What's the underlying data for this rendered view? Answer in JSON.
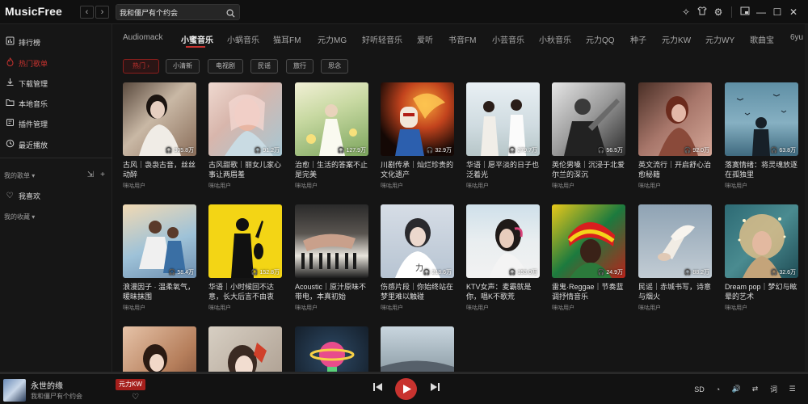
{
  "app": {
    "title": "MusicFree"
  },
  "search": {
    "value": "我和僵尸有个约会"
  },
  "sidebar": {
    "items": [
      {
        "label": "排行榜",
        "icon": "ranking-icon"
      },
      {
        "label": "热门歌单",
        "icon": "fire-icon"
      },
      {
        "label": "下载管理",
        "icon": "download-icon"
      },
      {
        "label": "本地音乐",
        "icon": "folder-icon"
      },
      {
        "label": "插件管理",
        "icon": "plugin-icon"
      },
      {
        "label": "最近播放",
        "icon": "clock-icon"
      }
    ],
    "my_playlists": "我的歌单",
    "favorites": "我喜欢",
    "my_collections": "我的收藏"
  },
  "tabs": [
    "Audiomack",
    "小蜜音乐",
    "小蜗音乐",
    "猫耳FM",
    "元力MG",
    "好听轻音乐",
    "爱听",
    "书音FM",
    "小芸音乐",
    "小秋音乐",
    "元力QQ",
    "种子",
    "元力KW",
    "元力WY",
    "歌曲宝",
    "6yu"
  ],
  "chips": [
    "热门",
    "小清新",
    "电视剧",
    "民谣",
    "旅行",
    "思念"
  ],
  "cards": [
    {
      "title": "古风｜袅袅古音，丝丝动醉",
      "count": "305.8万",
      "user": "咪咕用户"
    },
    {
      "title": "古风甜歌｜丽女儿家心事让两眉羞",
      "count": "91.2万",
      "user": "咪咕用户"
    },
    {
      "title": "治愈｜生活的答案不止是完美",
      "count": "127.9万",
      "user": "咪咕用户"
    },
    {
      "title": "川剧传承｜灿烂珍贵的文化遗产",
      "count": "32.9万",
      "user": "咪咕用户"
    },
    {
      "title": "华语｜愿平淡的日子也泛着光",
      "count": "279.7万",
      "user": "咪咕用户"
    },
    {
      "title": "英伦男嗓｜沉浸于北爱尔兰的深沉",
      "count": "56.5万",
      "user": "咪咕用户"
    },
    {
      "title": "英文流行｜开启舒心治愈秘籍",
      "count": "92.0万",
      "user": "咪咕用户"
    },
    {
      "title": "落寞情绪：将灵魂放逐在孤独里",
      "count": "63.8万",
      "user": "咪咕用户"
    },
    {
      "title": "浪漫因子 · 温柔氧气，暖昧抹围",
      "count": "58.4万",
      "user": "咪咕用户"
    },
    {
      "title": "华语｜小时候回不达意，长大后言不由衷",
      "count": "152.8万",
      "user": "咪咕用户"
    },
    {
      "title": "Acoustic｜原汁原味不带电，本真初始",
      "count": "",
      "user": "咪咕用户"
    },
    {
      "title": "伤感片段｜你始终站在梦里难以触碰",
      "count": "218.6万",
      "user": "咪咕用户"
    },
    {
      "title": "KTV女声：麦霸就是你，唱K不歌荒",
      "count": "153.0万",
      "user": "咪咕用户"
    },
    {
      "title": "雷鬼·Reggae｜节奏蓝调抒情音乐",
      "count": "24.9万",
      "user": "咪咕用户"
    },
    {
      "title": "民谣｜赤城书写，诗意与烟火",
      "count": "88.2万",
      "user": "咪咕用户"
    },
    {
      "title": "Dream pop｜梦幻与眩晕的艺术",
      "count": "32.6万",
      "user": "咪咕用户"
    },
    {
      "title": "",
      "count": "",
      "user": ""
    },
    {
      "title": "",
      "count": "",
      "user": ""
    },
    {
      "title": "",
      "count": "",
      "user": ""
    },
    {
      "title": "",
      "count": "",
      "user": ""
    },
    {
      "title": "",
      "count": "",
      "user": ""
    }
  ],
  "player": {
    "title": "永世的缘",
    "artist": "我和僵尸有个约会",
    "source": "元力KW",
    "quality": "SD",
    "lyrics_label": "词"
  },
  "colors": {
    "accent": "#c8332f",
    "background": "#151515"
  }
}
